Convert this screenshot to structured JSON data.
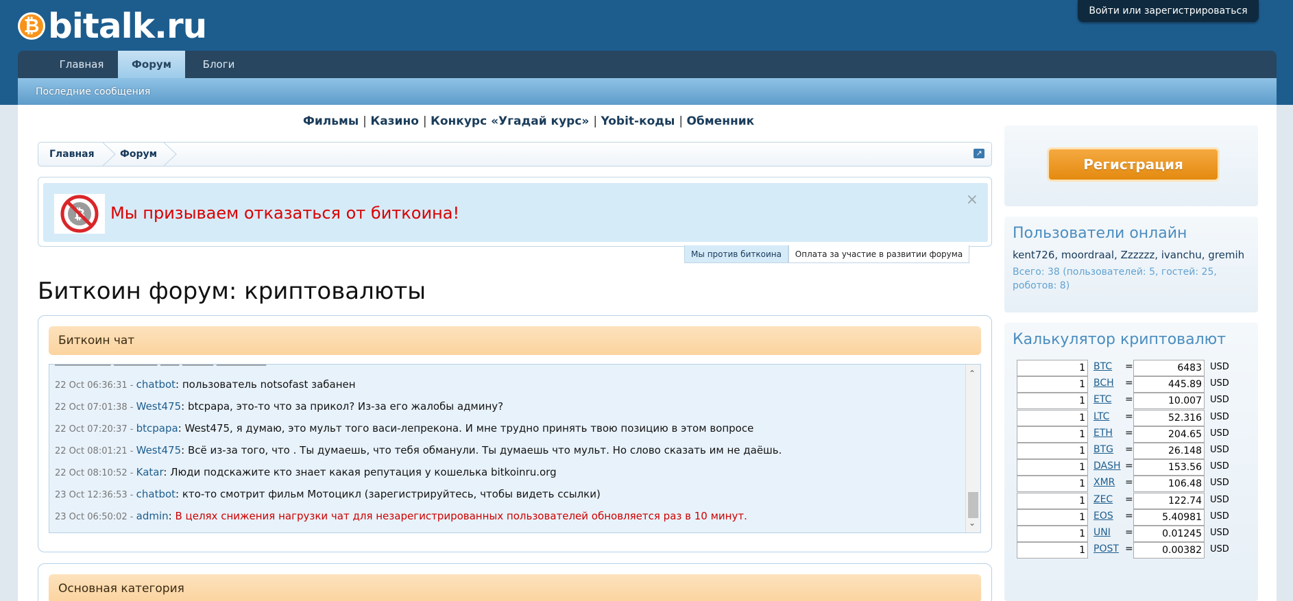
{
  "site": {
    "logo_symbol": "₿",
    "logo_text": "bitalk.ru",
    "login": "Войти или зарегистрироваться"
  },
  "nav": {
    "tabs": [
      {
        "label": "Главная"
      },
      {
        "label": "Форум"
      },
      {
        "label": "Блоги"
      }
    ],
    "subnav": "Последние сообщения"
  },
  "toplinks": [
    "Фильмы",
    "Казино",
    "Конкурс «Угадай курс»",
    "Yobit-коды",
    "Обменник"
  ],
  "breadcrumb": [
    "Главная",
    "Форум"
  ],
  "notice": {
    "text": "Мы призываем отказаться от биткоина!",
    "close": "×",
    "tabs": [
      "Мы против биткоина",
      "Оплата за участие в развитии форума"
    ]
  },
  "page_title": "Биткоин форум: криптовалюты",
  "chat": {
    "title": "Биткоин чат",
    "messages": [
      {
        "time": "22 Oct 06:36:31 - ",
        "user": "chatbot",
        "text": ": пользователь notsofast забанен"
      },
      {
        "time": "22 Oct 07:01:38 - ",
        "user": "West475",
        "text": ": btcpapa, это-то что за прикол? Из-за его жалобы админу?"
      },
      {
        "time": "22 Oct 07:20:37 - ",
        "user": "btcpapa",
        "text": ": West475, я думаю, это мульт того васи-лепрекона. И мне трудно принять твою позицию в этом вопросе"
      },
      {
        "time": "22 Oct 08:01:21 - ",
        "user": "West475",
        "text": ": Всё из-за того, что . Ты думаешь, что тебя обманули. Ты думаешь что мульт. Но слово сказать им не даёшь."
      },
      {
        "time": "22 Oct 08:10:52 - ",
        "user": "Katar",
        "text": ": Люди подскажите кто знает какая репутация у кошелька bitkoinru.org"
      },
      {
        "time": "23 Oct 12:36:53 - ",
        "user": "chatbot",
        "text": ": кто-то смотрит фильм Мотоцикл (зарегистрируйтесь, чтобы видеть ссылки)"
      },
      {
        "time": "23 Oct 06:50:02 - ",
        "user": "admin",
        "text": ": ",
        "red_text": "В целях снижения нагрузки чат для незарегистрированных пользователей обновляется раз в 10 минут."
      }
    ]
  },
  "category": {
    "title": "Основная категория"
  },
  "sidebar": {
    "register": "Регистрация",
    "online": {
      "title": "Пользователи онлайн",
      "users": "kent726, moordraal, Zzzzzz, ivanchu, gremih",
      "stats": "Всего: 38 (пользователей: 5, гостей: 25, роботов: 8)"
    },
    "calc": {
      "title": "Калькулятор криптовалют",
      "rows": [
        {
          "qty": "1",
          "coin": "BTC",
          "eq": "=",
          "value": "6483",
          "cur": "USD"
        },
        {
          "qty": "1",
          "coin": "BCH",
          "eq": "=",
          "value": "445.89",
          "cur": "USD"
        },
        {
          "qty": "1",
          "coin": "ETC",
          "eq": "=",
          "value": "10.007",
          "cur": "USD"
        },
        {
          "qty": "1",
          "coin": "LTC",
          "eq": "=",
          "value": "52.316",
          "cur": "USD"
        },
        {
          "qty": "1",
          "coin": "ETH",
          "eq": "=",
          "value": "204.65",
          "cur": "USD"
        },
        {
          "qty": "1",
          "coin": "BTG",
          "eq": "=",
          "value": "26.148",
          "cur": "USD"
        },
        {
          "qty": "1",
          "coin": "DASH",
          "eq": "=",
          "value": "153.56",
          "cur": "USD"
        },
        {
          "qty": "1",
          "coin": "XMR",
          "eq": "=",
          "value": "106.48",
          "cur": "USD"
        },
        {
          "qty": "1",
          "coin": "ZEC",
          "eq": "=",
          "value": "122.74",
          "cur": "USD"
        },
        {
          "qty": "1",
          "coin": "EOS",
          "eq": "=",
          "value": "5.40981",
          "cur": "USD"
        },
        {
          "qty": "1",
          "coin": "UNI",
          "eq": "=",
          "value": "0.01245",
          "cur": "USD"
        },
        {
          "qty": "1",
          "coin": "POST",
          "eq": "=",
          "value": "0.00382",
          "cur": "USD"
        }
      ]
    }
  }
}
